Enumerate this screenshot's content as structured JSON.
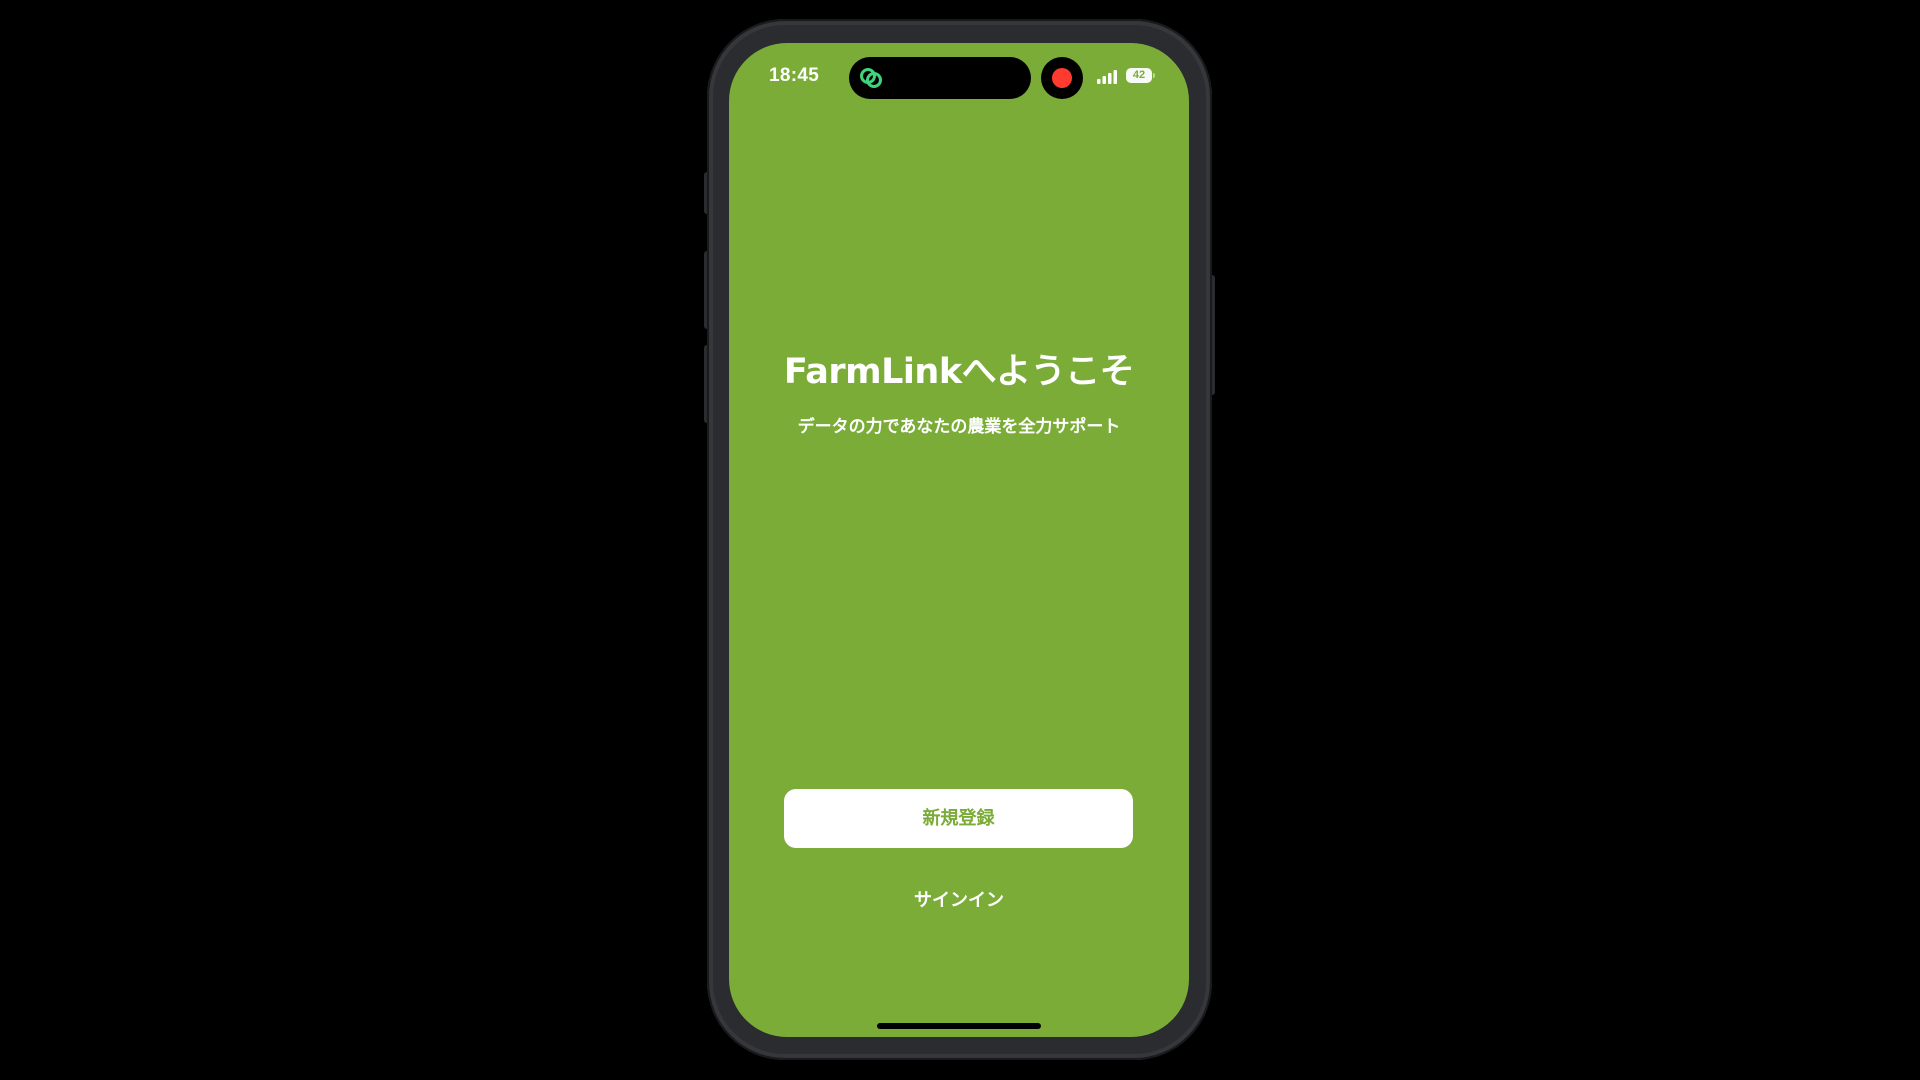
{
  "status_bar": {
    "time": "18:45",
    "battery_level": "42",
    "recording_color": "#ff3b30",
    "link_icon_color": "#3fd37a",
    "link_icon": "link-rings-icon",
    "signal_icon": "cellular-signal-icon",
    "battery_icon": "battery-icon"
  },
  "theme": {
    "background": "#7aac37",
    "accent": "#7aac37"
  },
  "welcome": {
    "title": "FarmLinkへようこそ",
    "subtitle": "データの力であなたの農業を全力サポート"
  },
  "actions": {
    "register_label": "新規登録",
    "signin_label": "サインイン"
  }
}
